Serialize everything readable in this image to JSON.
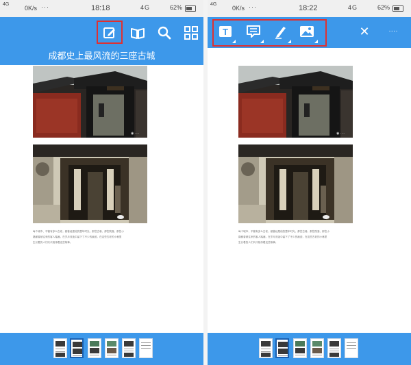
{
  "status_left": {
    "signal": "4G",
    "speed": "0K/s",
    "dots": "···",
    "time": "18:18",
    "network": "4G",
    "battery": "62%"
  },
  "status_right": {
    "signal": "4G",
    "speed": "0K/s",
    "dots": "···",
    "time": "18:22",
    "network": "4G",
    "battery": "62%"
  },
  "left_toolbar": {
    "icons": [
      "edit-icon",
      "book-icon",
      "search-icon",
      "grid-icon"
    ],
    "title": "成都史上最风流的三座古城"
  },
  "right_toolbar": {
    "icons": [
      "text-tool-icon",
      "comment-tool-icon",
      "pen-tool-icon",
      "image-tool-icon",
      "close-icon",
      "more-icon"
    ],
    "close_label": "✕",
    "more_label": "····"
  },
  "document": {
    "paragraph_lines": [
      "每个城市、不管有多么古老，都曾经是他的童年时光，那些古巷、那些院落、那些小",
      "路都曾被往来的客人踏遍，在岁月流逝中留下了不少的痕迹，在这些古老的小巷里",
      "生长着的人们代代相传着这些故事。"
    ]
  },
  "pages": {
    "count": 6,
    "selected_left": 1,
    "selected_right": 1
  },
  "colors": {
    "accent": "#3d98ea",
    "highlight": "#e03030",
    "statusbar": "#f0f0f0"
  }
}
